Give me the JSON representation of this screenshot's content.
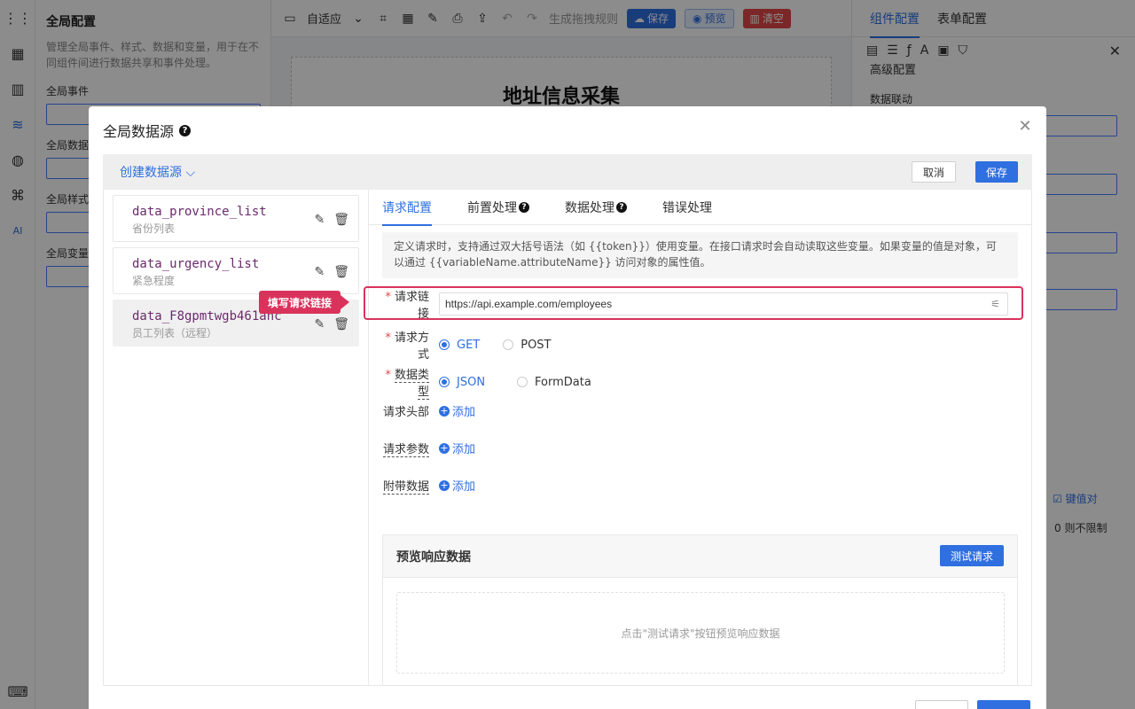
{
  "left_panel": {
    "title": "全局配置",
    "description": "管理全局事件、样式、数据和变量，用于在不同组件间进行数据共享和事件处理。",
    "sections": [
      "全局事件",
      "全局数据",
      "全局样式",
      "全局变量"
    ]
  },
  "toolbar": {
    "layout_label": "自适应",
    "generate_rules_label": "生成拖拽规则",
    "save_label": "保存",
    "preview_label": "预览",
    "clear_label": "清空"
  },
  "canvas": {
    "form_title": "地址信息采集"
  },
  "right_panel": {
    "tabs": [
      "组件配置",
      "表单配置"
    ],
    "advanced_label": "高级配置",
    "linkage_label": "数据联动",
    "keyvalue_label": "键值对",
    "limit_label": "0 则不限制"
  },
  "modal": {
    "title": "全局数据源",
    "create_label": "创建数据源",
    "cancel_label": "取消",
    "save_label": "保存",
    "datasources": [
      {
        "name": "data_province_list",
        "desc": "省份列表"
      },
      {
        "name": "data_urgency_list",
        "desc": "紧急程度"
      },
      {
        "name": "data_F8gpmtwgb461anc",
        "desc": "员工列表（远程）"
      }
    ],
    "tabs": [
      {
        "label": "请求配置",
        "help": false
      },
      {
        "label": "前置处理",
        "help": true
      },
      {
        "label": "数据处理",
        "help": true
      },
      {
        "label": "错误处理",
        "help": false
      }
    ],
    "info_text": "定义请求时，支持通过双大括号语法（如 {{token}}）使用变量。在接口请求时会自动读取这些变量。如果变量的值是对象，可以通过 {{variableName.attributeName}} 访问对象的属性值。",
    "form": {
      "url_label": "请求链接",
      "url_value": "https://api.example.com/employees",
      "method_label": "请求方式",
      "method_options": [
        "GET",
        "POST"
      ],
      "type_label": "数据类型",
      "type_options": [
        "JSON",
        "FormData"
      ],
      "headers_label": "请求头部",
      "params_label": "请求参数",
      "extra_label": "附带数据",
      "add_label": "添加"
    },
    "preview": {
      "title": "预览响应数据",
      "test_label": "测试请求",
      "empty_text": "点击\"测试请求\"按钮预览响应数据"
    },
    "callout": "填写请求链接"
  },
  "colors": {
    "accent": "#2f6fe0",
    "danger": "#e04848",
    "highlight": "#d9335c"
  }
}
